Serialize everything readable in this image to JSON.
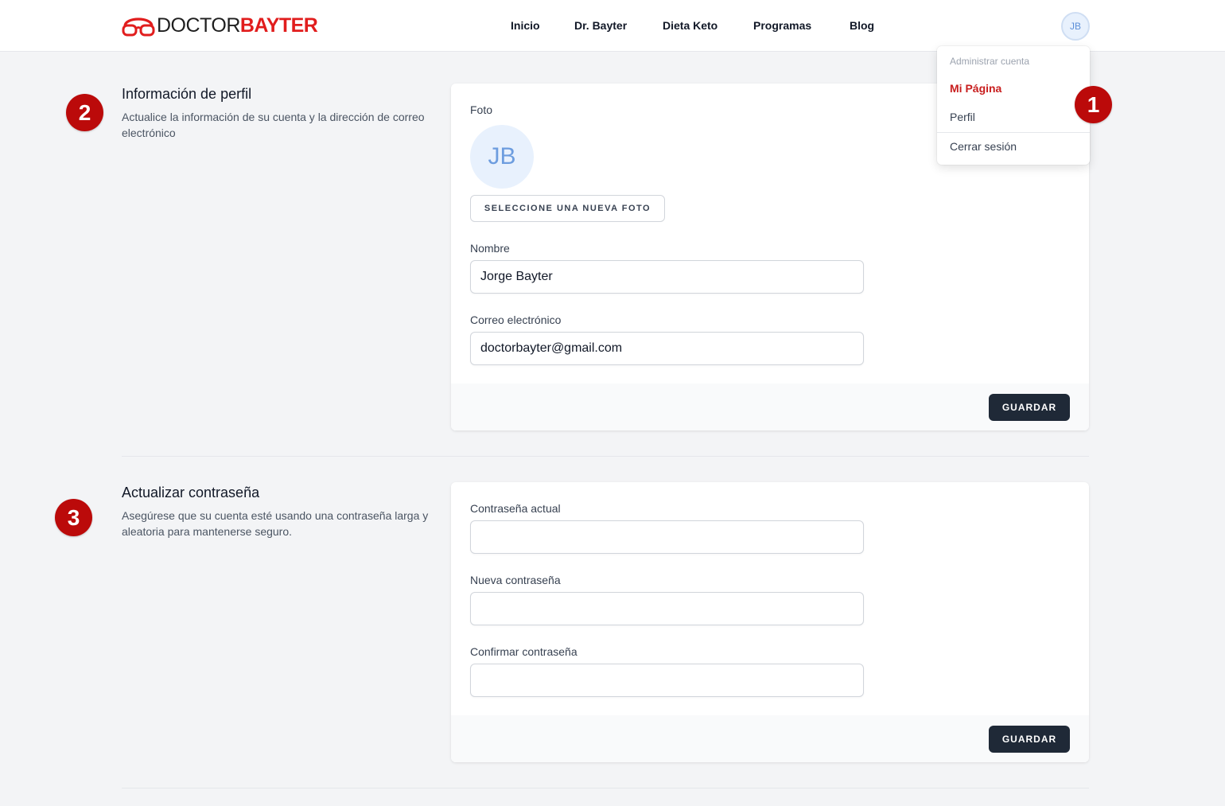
{
  "header": {
    "logo": {
      "part1": "DOCTOR",
      "part2": "BAYTER"
    },
    "nav": [
      "Inicio",
      "Dr. Bayter",
      "Dieta Keto",
      "Programas",
      "Blog"
    ],
    "avatar_initials": "JB"
  },
  "dropdown": {
    "heading": "Administrar cuenta",
    "items": [
      "Mi Página",
      "Perfil",
      "Cerrar sesión"
    ]
  },
  "steps": [
    "1",
    "2",
    "3"
  ],
  "profile": {
    "title": "Información de perfil",
    "description": "Actualice la información de su cuenta y la dirección de correo electrónico",
    "photo_label": "Foto",
    "photo_initials": "JB",
    "select_photo_button": "SELECCIONE UNA NUEVA FOTO",
    "name_label": "Nombre",
    "name_value": "Jorge Bayter",
    "email_label": "Correo electrónico",
    "email_value": "doctorbayter@gmail.com",
    "save_button": "GUARDAR"
  },
  "password": {
    "title": "Actualizar contraseña",
    "description": "Asegúrese que su cuenta esté usando una contraseña larga y aleatoria para mantenerse seguro.",
    "current_label": "Contraseña actual",
    "current_value": "",
    "new_label": "Nueva contraseña",
    "new_value": "",
    "confirm_label": "Confirmar contraseña",
    "confirm_value": "",
    "save_button": "GUARDAR"
  },
  "colors": {
    "brand_red": "#e11d1d",
    "badge_red": "#bb0a0a",
    "dark_button": "#1f2937"
  }
}
